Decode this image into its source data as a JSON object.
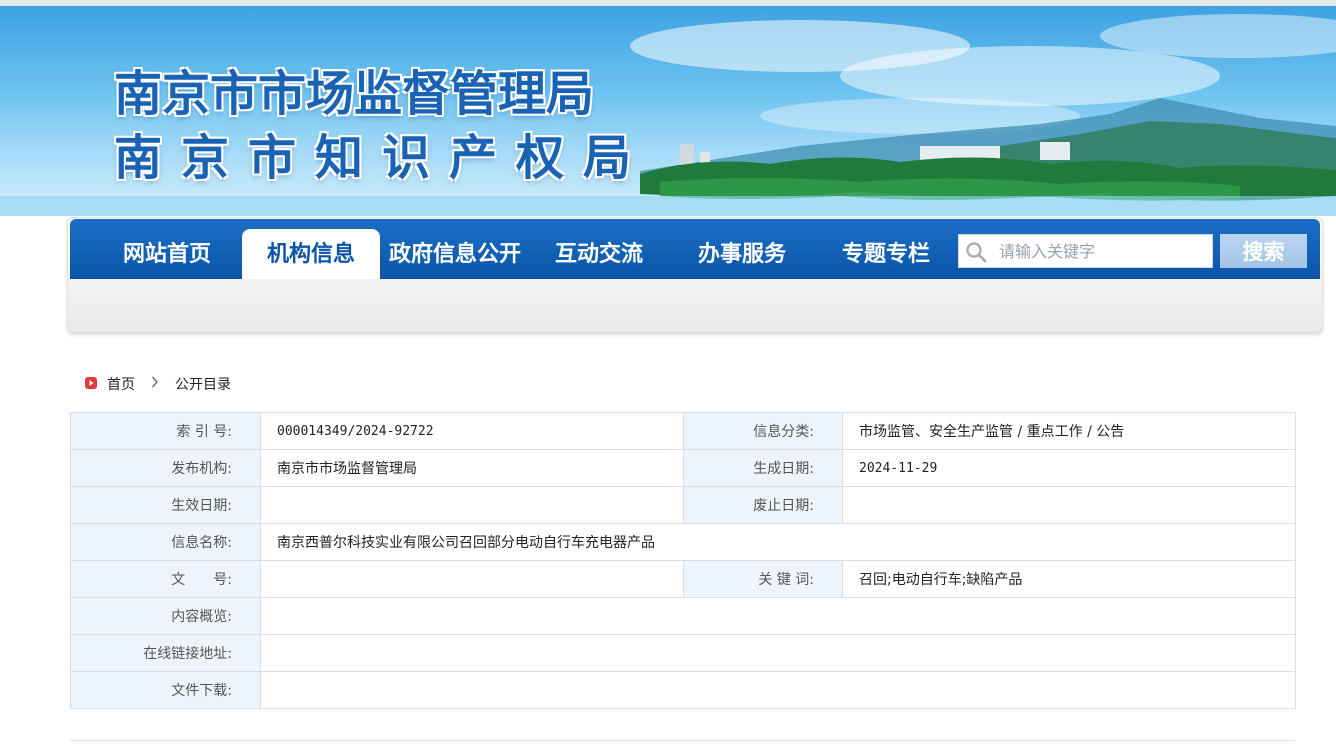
{
  "site": {
    "title_line1": "南京市市场监督管理局",
    "title_line2": "南京市知识产权局"
  },
  "nav": {
    "items": [
      {
        "label": "网站首页"
      },
      {
        "label": "机构信息",
        "active": true
      },
      {
        "label": "政府信息公开"
      },
      {
        "label": "互动交流"
      },
      {
        "label": "办事服务"
      },
      {
        "label": "专题专栏"
      }
    ],
    "search_placeholder": "请输入关键字",
    "search_button": "搜索"
  },
  "breadcrumb": {
    "home": "首页",
    "current": "公开目录"
  },
  "info": {
    "index_no_label": "索 引 号:",
    "index_no": "000014349/2024-92722",
    "category_label": "信息分类:",
    "category": "市场监管、安全生产监管 / 重点工作 / 公告",
    "publisher_label": "发布机构:",
    "publisher": "南京市市场监督管理局",
    "created_label": "生成日期:",
    "created": "2024-11-29",
    "effective_label": "生效日期:",
    "effective": "",
    "abolish_label": "废止日期:",
    "abolish": "",
    "name_label": "信息名称:",
    "name": "南京西普尔科技实业有限公司召回部分电动自行车充电器产品",
    "doc_no_label": "文　　号:",
    "doc_no": "",
    "keywords_label": "关 键 词:",
    "keywords": "召回;电动自行车;缺陷产品",
    "summary_label": "内容概览:",
    "summary": "",
    "link_label": "在线链接地址:",
    "link": "",
    "download_label": "文件下载:",
    "download": ""
  },
  "colors": {
    "nav_blue": "#0b55a8",
    "title_blue": "#1a63b4",
    "label_bg": "#eef4fb",
    "breadcrumb_icon": "#e23b3b"
  }
}
